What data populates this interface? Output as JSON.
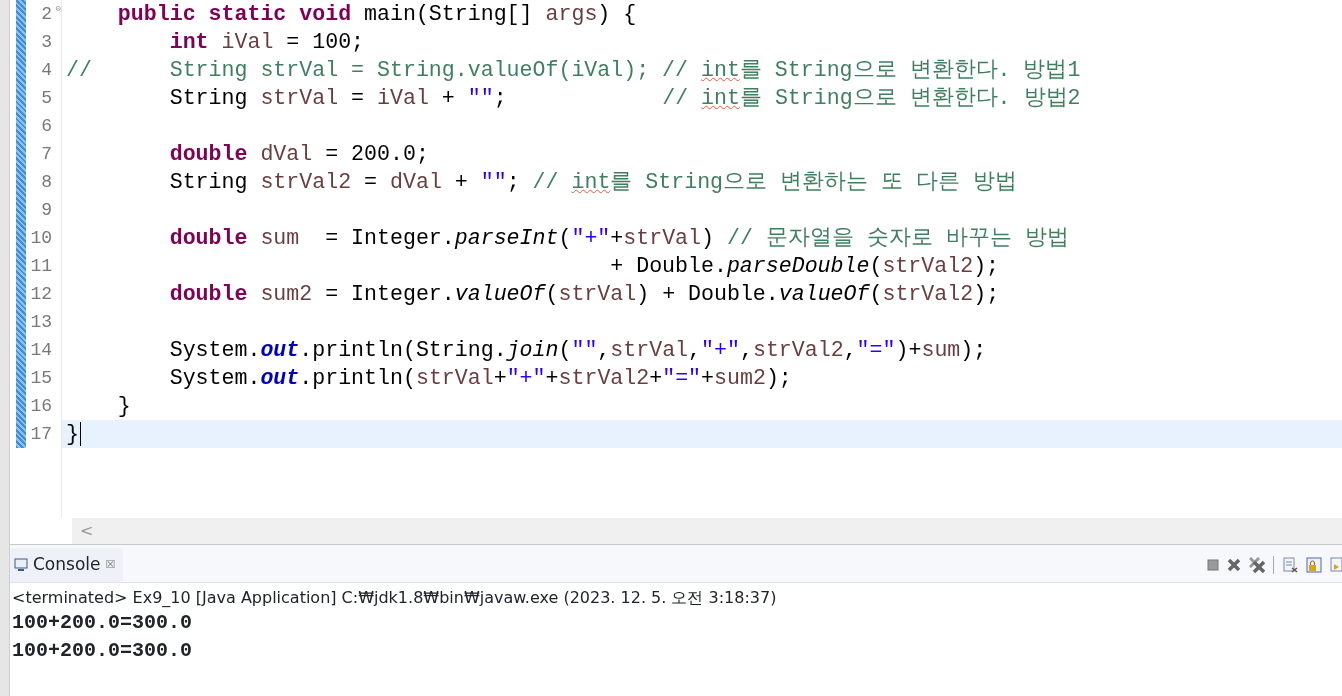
{
  "editor": {
    "lines": [
      {
        "number": "2",
        "fold_marker": "⊝",
        "current": false,
        "tokens": [
          {
            "kind": "keyword",
            "text": "    public"
          },
          {
            "kind": "keyword",
            "text": " static"
          },
          {
            "kind": "keyword",
            "text": " void"
          },
          {
            "kind": "plain",
            "text": " main(String[] "
          },
          {
            "kind": "variable",
            "text": "args"
          },
          {
            "kind": "plain",
            "text": ") {"
          }
        ]
      },
      {
        "number": "3",
        "current": false,
        "tokens": [
          {
            "kind": "keyword",
            "text": "        int"
          },
          {
            "kind": "variable",
            "text": " iVal"
          },
          {
            "kind": "plain",
            "text": " = 100;"
          }
        ]
      },
      {
        "number": "4",
        "current": false,
        "tokens": [
          {
            "kind": "comment",
            "text": "//      String strVal = String.valueOf(iVal); // "
          },
          {
            "kind": "misspelled",
            "text": "int"
          },
          {
            "kind": "comment",
            "text": "를 String으로 변환한다. 방법1"
          }
        ]
      },
      {
        "number": "5",
        "current": false,
        "tokens": [
          {
            "kind": "plain",
            "text": "        String "
          },
          {
            "kind": "variable",
            "text": "strVal"
          },
          {
            "kind": "plain",
            "text": " = "
          },
          {
            "kind": "variable",
            "text": "iVal"
          },
          {
            "kind": "plain",
            "text": " + "
          },
          {
            "kind": "string",
            "text": "\"\""
          },
          {
            "kind": "plain",
            "text": ";"
          },
          {
            "kind": "comment",
            "text": "            // "
          },
          {
            "kind": "misspelled",
            "text": "int"
          },
          {
            "kind": "comment",
            "text": "를 String으로 변환한다. 방법2"
          }
        ]
      },
      {
        "number": "6",
        "current": false
      },
      {
        "number": "7",
        "current": false,
        "tokens": [
          {
            "kind": "keyword",
            "text": "        double"
          },
          {
            "kind": "variable",
            "text": " dVal"
          },
          {
            "kind": "plain",
            "text": " = 200.0;"
          }
        ]
      },
      {
        "number": "8",
        "current": false,
        "tokens": [
          {
            "kind": "plain",
            "text": "        String "
          },
          {
            "kind": "variable",
            "text": "strVal2"
          },
          {
            "kind": "plain",
            "text": " = "
          },
          {
            "kind": "variable",
            "text": "dVal"
          },
          {
            "kind": "plain",
            "text": " + "
          },
          {
            "kind": "string",
            "text": "\"\""
          },
          {
            "kind": "plain",
            "text": ";"
          },
          {
            "kind": "comment",
            "text": " // "
          },
          {
            "kind": "misspelled",
            "text": "int"
          },
          {
            "kind": "comment",
            "text": "를 String으로 변환하는 또 다른 방법"
          }
        ]
      },
      {
        "number": "9",
        "current": false
      },
      {
        "number": "10",
        "current": false,
        "tokens": [
          {
            "kind": "keyword",
            "text": "        double"
          },
          {
            "kind": "variable",
            "text": " sum"
          },
          {
            "kind": "plain",
            "text": "  = Integer."
          },
          {
            "kind": "static-method",
            "text": "parseInt"
          },
          {
            "kind": "plain",
            "text": "("
          },
          {
            "kind": "string",
            "text": "\"+\""
          },
          {
            "kind": "plain",
            "text": "+"
          },
          {
            "kind": "variable",
            "text": "strVal"
          },
          {
            "kind": "plain",
            "text": ")"
          },
          {
            "kind": "comment",
            "text": " // 문자열을 숫자로 바꾸는 방법"
          }
        ]
      },
      {
        "number": "11",
        "current": false,
        "tokens": [
          {
            "kind": "plain",
            "text": "                                          + Double."
          },
          {
            "kind": "static-method",
            "text": "parseDouble"
          },
          {
            "kind": "plain",
            "text": "("
          },
          {
            "kind": "variable",
            "text": "strVal2"
          },
          {
            "kind": "plain",
            "text": ");"
          }
        ]
      },
      {
        "number": "12",
        "current": false,
        "tokens": [
          {
            "kind": "keyword",
            "text": "        double"
          },
          {
            "kind": "variable",
            "text": " sum2"
          },
          {
            "kind": "plain",
            "text": " = Integer."
          },
          {
            "kind": "static-method",
            "text": "valueOf"
          },
          {
            "kind": "plain",
            "text": "("
          },
          {
            "kind": "variable",
            "text": "strVal"
          },
          {
            "kind": "plain",
            "text": ") + Double."
          },
          {
            "kind": "static-method",
            "text": "valueOf"
          },
          {
            "kind": "plain",
            "text": "("
          },
          {
            "kind": "variable",
            "text": "strVal2"
          },
          {
            "kind": "plain",
            "text": ");"
          }
        ]
      },
      {
        "number": "13",
        "current": false
      },
      {
        "number": "14",
        "current": false,
        "tokens": [
          {
            "kind": "plain",
            "text": "        System."
          },
          {
            "kind": "static-field",
            "text": "out"
          },
          {
            "kind": "plain",
            "text": ".println(String."
          },
          {
            "kind": "static-method",
            "text": "join"
          },
          {
            "kind": "plain",
            "text": "("
          },
          {
            "kind": "string",
            "text": "\"\""
          },
          {
            "kind": "plain",
            "text": ","
          },
          {
            "kind": "variable",
            "text": "strVal"
          },
          {
            "kind": "plain",
            "text": ","
          },
          {
            "kind": "string",
            "text": "\"+\""
          },
          {
            "kind": "plain",
            "text": ","
          },
          {
            "kind": "variable",
            "text": "strVal2"
          },
          {
            "kind": "plain",
            "text": ","
          },
          {
            "kind": "string",
            "text": "\"=\""
          },
          {
            "kind": "plain",
            "text": ")+"
          },
          {
            "kind": "variable",
            "text": "sum"
          },
          {
            "kind": "plain",
            "text": ");"
          }
        ]
      },
      {
        "number": "15",
        "current": false,
        "tokens": [
          {
            "kind": "plain",
            "text": "        System."
          },
          {
            "kind": "static-field",
            "text": "out"
          },
          {
            "kind": "plain",
            "text": ".println("
          },
          {
            "kind": "variable",
            "text": "strVal"
          },
          {
            "kind": "plain",
            "text": "+"
          },
          {
            "kind": "string",
            "text": "\"+\""
          },
          {
            "kind": "plain",
            "text": "+"
          },
          {
            "kind": "variable",
            "text": "strVal2"
          },
          {
            "kind": "plain",
            "text": "+"
          },
          {
            "kind": "string",
            "text": "\"=\""
          },
          {
            "kind": "plain",
            "text": "+"
          },
          {
            "kind": "variable",
            "text": "sum2"
          },
          {
            "kind": "plain",
            "text": ");"
          }
        ]
      },
      {
        "number": "16",
        "current": false,
        "tokens": [
          {
            "kind": "plain",
            "text": "    }"
          }
        ]
      },
      {
        "number": "17",
        "current": true,
        "tokens": [
          {
            "kind": "plain",
            "text": "}"
          }
        ]
      }
    ],
    "scroll_left": "<"
  },
  "console": {
    "tab": {
      "label": "Console",
      "close": "☒"
    },
    "status": "<terminated> Ex9_10 [Java Application] C:₩jdk1.8₩bin₩javaw.exe (2023. 12. 5. 오전 3:18:37)",
    "output": [
      "100+200.0=300.0",
      "100+200.0=300.0"
    ]
  }
}
